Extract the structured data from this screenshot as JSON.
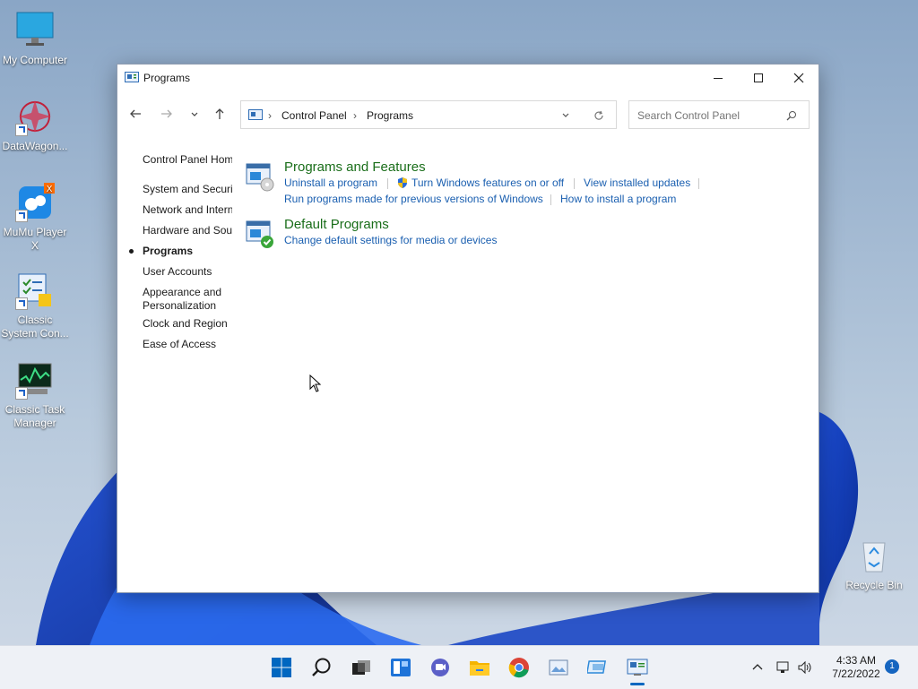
{
  "desktop": {
    "icons": [
      {
        "label": "My Computer",
        "icon": "monitor-icon"
      },
      {
        "label": "DataWagon...",
        "icon": "datawagon-icon"
      },
      {
        "label": "MuMu Player X",
        "icon": "mumu-player-icon"
      },
      {
        "label": "Classic System Con...",
        "icon": "control-panel-icon"
      },
      {
        "label": "Classic Task Manager",
        "icon": "task-manager-icon"
      },
      {
        "label": "Recycle Bin",
        "icon": "recycle-bin-icon"
      }
    ]
  },
  "window": {
    "title": "Programs",
    "controls": {
      "minimize": "minimize-icon",
      "maximize": "maximize-icon",
      "close": "close-icon"
    }
  },
  "address_bar": {
    "crumbs": [
      "Control Panel",
      "Programs"
    ],
    "separator": "›"
  },
  "search": {
    "placeholder": "Search Control Panel"
  },
  "sidebar": {
    "items": [
      {
        "label": "Control Panel Home"
      },
      {
        "label": "System and Security"
      },
      {
        "label": "Network and Internet"
      },
      {
        "label": "Hardware and Sound"
      },
      {
        "label": "Programs",
        "active": true
      },
      {
        "label": "User Accounts"
      },
      {
        "label": "Appearance and"
      },
      {
        "label": "Personalization"
      },
      {
        "label": "Clock and Region"
      },
      {
        "label": "Ease of Access"
      }
    ]
  },
  "main": {
    "categories": [
      {
        "title": "Programs and Features",
        "links": [
          "Uninstall a program",
          "Turn Windows features on or off",
          "View installed updates",
          "Run programs made for previous versions of Windows",
          "How to install a program"
        ]
      },
      {
        "title": "Default Programs",
        "links": [
          "Change default settings for media or devices"
        ]
      }
    ]
  },
  "taskbar": {
    "time": "4:33 AM",
    "date": "7/22/2022",
    "notification_count": "1"
  },
  "colors": {
    "link": "#1a5fb0",
    "category_title": "#1a6e1a",
    "accent": "#0067c0"
  }
}
